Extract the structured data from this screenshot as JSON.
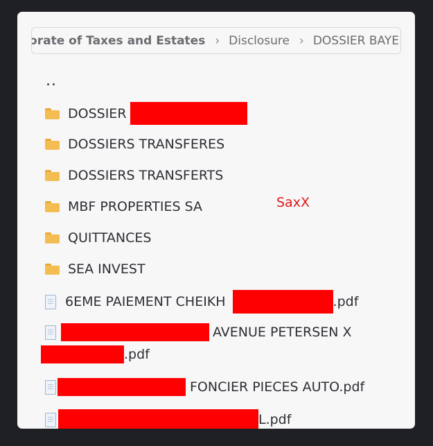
{
  "breadcrumb": {
    "items": [
      "Directorate of Taxes and Estates",
      "Disclosure",
      "DOSSIER BAYE"
    ],
    "separator": "›"
  },
  "files": {
    "parent": "..",
    "folders": [
      {
        "name": "DOSSIER",
        "redacted": true
      },
      {
        "name": "DOSSIERS TRANSFERES"
      },
      {
        "name": "DOSSIERS TRANSFERTS"
      },
      {
        "name": "MBF PROPERTIES SA"
      },
      {
        "name": "QUITTANCES"
      },
      {
        "name": "SEA INVEST"
      }
    ],
    "pdfs": [
      {
        "before": "6EME PAIEMENT CHEIKH",
        "after": ".pdf"
      },
      {
        "line1_after": "AVENUE PETERSEN X",
        "line2_after": ".pdf"
      },
      {
        "after": "FONCIER PIECES AUTO.pdf"
      },
      {
        "after": "L.pdf"
      }
    ]
  },
  "annotation": "SaxX",
  "colors": {
    "background": "#1e2024",
    "panel": "#f7f7f8",
    "redaction": "#ff0000",
    "annotation": "#e21818"
  }
}
